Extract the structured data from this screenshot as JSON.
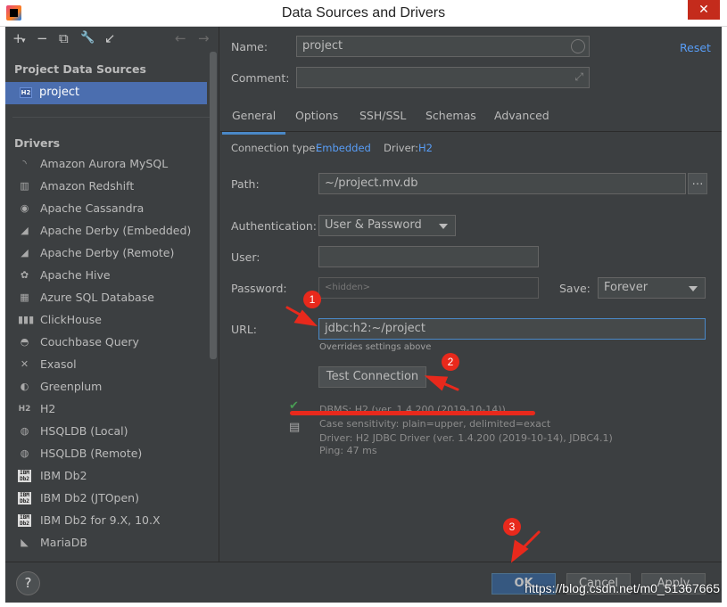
{
  "window": {
    "title": "Data Sources and Drivers",
    "close": "✕"
  },
  "left": {
    "toolbar": {
      "add": "+",
      "add_arrow": "▾",
      "remove": "−",
      "copy": "⧉",
      "settings": "🔧",
      "import": "↙",
      "back": "←",
      "forward": "→"
    },
    "project_sources_heading": "Project Data Sources",
    "selected_source": {
      "badge": "H2",
      "label": "project"
    },
    "drivers_heading": "Drivers",
    "drivers": [
      {
        "label": "Amazon Aurora MySQL",
        "icon": "aurora-icon",
        "glyph": "◝"
      },
      {
        "label": "Amazon Redshift",
        "icon": "redshift-icon",
        "glyph": "▥"
      },
      {
        "label": "Apache Cassandra",
        "icon": "cassandra-icon",
        "glyph": "◉"
      },
      {
        "label": "Apache Derby (Embedded)",
        "icon": "derby-icon",
        "glyph": "◢"
      },
      {
        "label": "Apache Derby (Remote)",
        "icon": "derby-icon",
        "glyph": "◢"
      },
      {
        "label": "Apache Hive",
        "icon": "hive-icon",
        "glyph": "✿"
      },
      {
        "label": "Azure SQL Database",
        "icon": "azure-icon",
        "glyph": "▦"
      },
      {
        "label": "ClickHouse",
        "icon": "clickhouse-icon",
        "glyph": "▮▮▮"
      },
      {
        "label": "Couchbase Query",
        "icon": "couchbase-icon",
        "glyph": "◓"
      },
      {
        "label": "Exasol",
        "icon": "exasol-icon",
        "glyph": "✕"
      },
      {
        "label": "Greenplum",
        "icon": "greenplum-icon",
        "glyph": "◐"
      },
      {
        "label": "H2",
        "icon": "h2-icon",
        "glyph": "H2"
      },
      {
        "label": "HSQLDB (Local)",
        "icon": "hsqldb-icon",
        "glyph": "◍"
      },
      {
        "label": "HSQLDB (Remote)",
        "icon": "hsqldb-icon",
        "glyph": "◍"
      },
      {
        "label": "IBM Db2",
        "icon": "ibm-db2-icon",
        "glyph": "IBM Db2"
      },
      {
        "label": "IBM Db2 (JTOpen)",
        "icon": "ibm-db2-icon",
        "glyph": "IBM Db2"
      },
      {
        "label": "IBM Db2 for 9.X, 10.X",
        "icon": "ibm-db2-icon",
        "glyph": "IBM Db2"
      },
      {
        "label": "MariaDB",
        "icon": "mariadb-icon",
        "glyph": "◣"
      }
    ]
  },
  "form": {
    "name_label": "Name:",
    "name_value": "project",
    "reset": "Reset",
    "comment_label": "Comment:",
    "comment_value": "",
    "expand_glyph": "⤢",
    "tabs": [
      "General",
      "Options",
      "SSH/SSL",
      "Schemas",
      "Advanced"
    ],
    "connection_type_label": "Connection type:",
    "connection_type_value": "Embedded",
    "driver_label": "Driver:",
    "driver_value": "H2",
    "path_label": "Path:",
    "path_value": "~/project.mv.db",
    "browse": "…",
    "auth_label": "Authentication:",
    "auth_value": "User & Password",
    "user_label": "User:",
    "user_value": "",
    "password_label": "Password:",
    "password_placeholder": "<hidden>",
    "save_label": "Save:",
    "save_value": "Forever",
    "url_label": "URL:",
    "url_value": "jdbc:h2:~/project",
    "url_hint": "Overrides settings above",
    "test_button": "Test Connection",
    "result": {
      "check": "✔",
      "copy": "▤",
      "lines": [
        "DBMS: H2 (ver. 1.4.200 (2019-10-14))",
        "Case sensitivity: plain=upper, delimited=exact",
        "Driver: H2 JDBC Driver (ver. 1.4.200 (2019-10-14), JDBC4.1)",
        "Ping: 47 ms"
      ]
    }
  },
  "footer": {
    "help": "?",
    "ok": "OK",
    "cancel": "Cancel",
    "apply": "Apply"
  },
  "annotations": {
    "one": "1",
    "two": "2",
    "three": "3",
    "color": "#e8291c"
  },
  "watermark": "https://blog.csdn.net/m0_51367665"
}
